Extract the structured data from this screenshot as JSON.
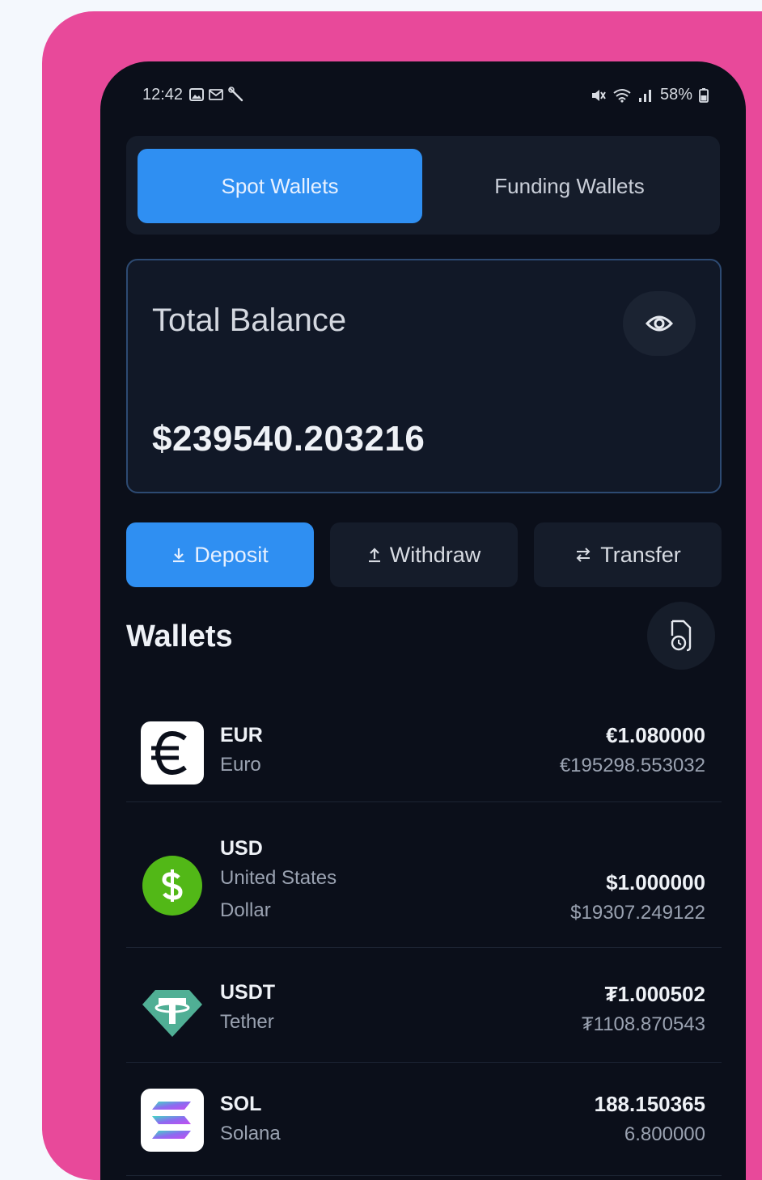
{
  "status_bar": {
    "time": "12:42",
    "battery": "58%",
    "left_icons": [
      "gallery-icon",
      "mail-icon",
      "wrench-icon"
    ],
    "right_icons": [
      "mute-icon",
      "wifi-icon",
      "signal-icon",
      "battery-icon"
    ]
  },
  "tabs": {
    "spot": "Spot Wallets",
    "funding": "Funding Wallets",
    "active": "spot"
  },
  "balance": {
    "title": "Total Balance",
    "value": "$239540.203216"
  },
  "actions": {
    "deposit": "Deposit",
    "withdraw": "Withdraw",
    "transfer": "Transfer"
  },
  "wallets": {
    "heading": "Wallets",
    "items": [
      {
        "symbol": "EUR",
        "name": "Euro",
        "price": "€1.080000",
        "holding": "€195298.553032",
        "icon": "euro-icon"
      },
      {
        "symbol": "USD",
        "name": "United States Dollar",
        "price": "$1.000000",
        "holding": "$19307.249122",
        "icon": "dollar-icon"
      },
      {
        "symbol": "USDT",
        "name": "Tether",
        "price": "₮1.000502",
        "holding": "₮1108.870543",
        "icon": "tether-icon"
      },
      {
        "symbol": "SOL",
        "name": "Solana",
        "price": "188.150365",
        "holding": "6.800000",
        "icon": "solana-icon"
      }
    ]
  },
  "colors": {
    "page_background": "#f4f8fd",
    "frame_pink": "#e8499a",
    "phone_background": "#0b0f1a",
    "accent_blue": "#2f8ff2",
    "usd_green": "#52b817",
    "tether_teal": "#50af95"
  }
}
